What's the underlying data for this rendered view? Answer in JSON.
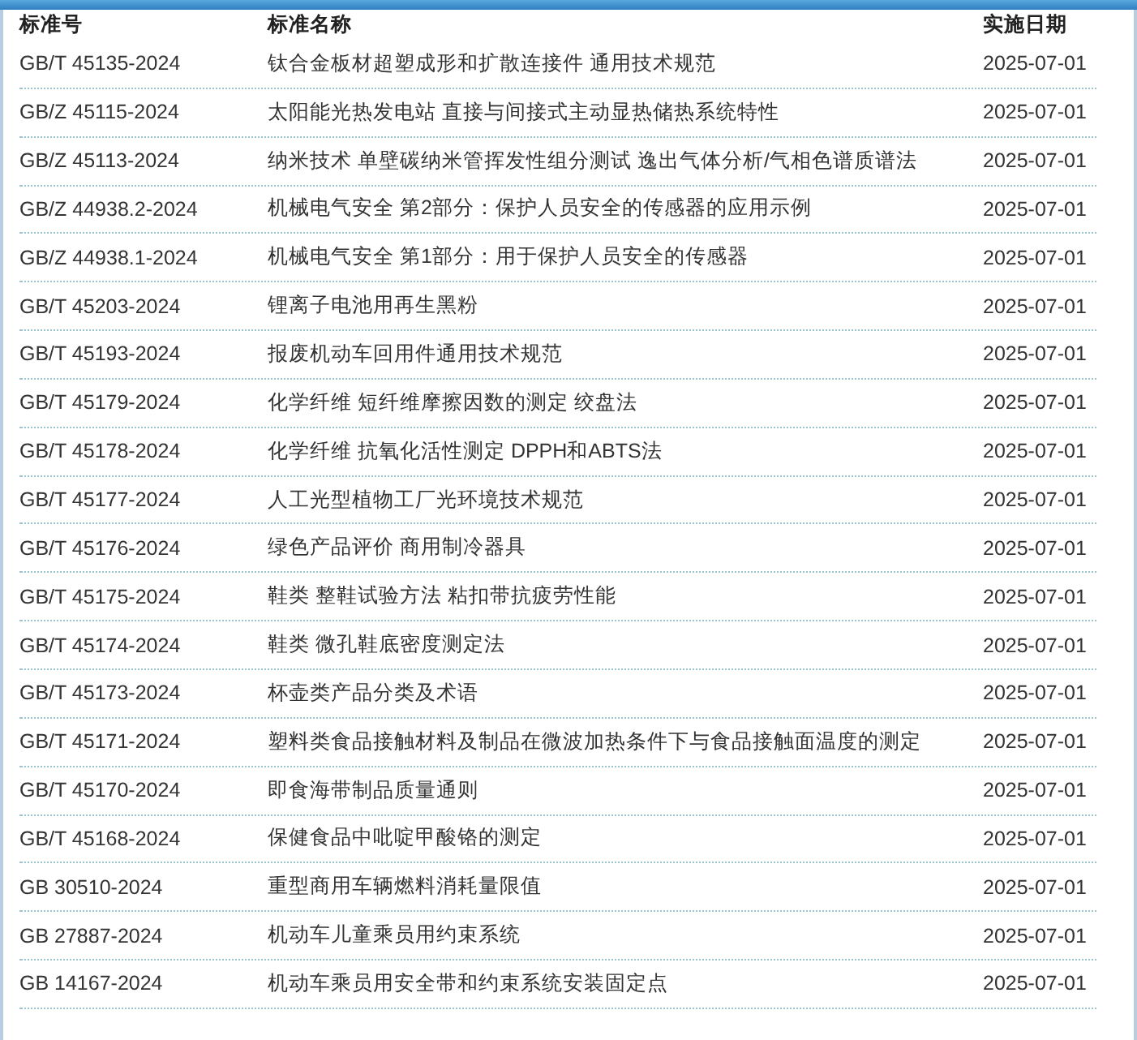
{
  "table": {
    "columns": [
      "标准号",
      "标准名称",
      "实施日期"
    ],
    "rows": [
      {
        "code": "GB/T 45135-2024",
        "name": "钛合金板材超塑成形和扩散连接件 通用技术规范",
        "date": "2025-07-01"
      },
      {
        "code": "GB/Z 45115-2024",
        "name": "太阳能光热发电站 直接与间接式主动显热储热系统特性",
        "date": "2025-07-01"
      },
      {
        "code": "GB/Z 45113-2024",
        "name": "纳米技术 单壁碳纳米管挥发性组分测试 逸出气体分析/气相色谱质谱法",
        "date": "2025-07-01"
      },
      {
        "code": "GB/Z 44938.2-2024",
        "name": "机械电气安全 第2部分：保护人员安全的传感器的应用示例",
        "date": "2025-07-01"
      },
      {
        "code": "GB/Z 44938.1-2024",
        "name": "机械电气安全 第1部分：用于保护人员安全的传感器",
        "date": "2025-07-01"
      },
      {
        "code": "GB/T 45203-2024",
        "name": "锂离子电池用再生黑粉",
        "date": "2025-07-01"
      },
      {
        "code": "GB/T 45193-2024",
        "name": "报废机动车回用件通用技术规范",
        "date": "2025-07-01"
      },
      {
        "code": "GB/T 45179-2024",
        "name": "化学纤维 短纤维摩擦因数的测定 绞盘法",
        "date": "2025-07-01"
      },
      {
        "code": "GB/T 45178-2024",
        "name": "化学纤维 抗氧化活性测定 DPPH和ABTS法",
        "date": "2025-07-01"
      },
      {
        "code": "GB/T 45177-2024",
        "name": "人工光型植物工厂光环境技术规范",
        "date": "2025-07-01"
      },
      {
        "code": "GB/T 45176-2024",
        "name": "绿色产品评价 商用制冷器具",
        "date": "2025-07-01"
      },
      {
        "code": "GB/T 45175-2024",
        "name": "鞋类 整鞋试验方法 粘扣带抗疲劳性能",
        "date": "2025-07-01"
      },
      {
        "code": "GB/T 45174-2024",
        "name": "鞋类 微孔鞋底密度测定法",
        "date": "2025-07-01"
      },
      {
        "code": "GB/T 45173-2024",
        "name": "杯壶类产品分类及术语",
        "date": "2025-07-01"
      },
      {
        "code": "GB/T 45171-2024",
        "name": "塑料类食品接触材料及制品在微波加热条件下与食品接触面温度的测定",
        "date": "2025-07-01"
      },
      {
        "code": "GB/T 45170-2024",
        "name": "即食海带制品质量通则",
        "date": "2025-07-01"
      },
      {
        "code": "GB/T 45168-2024",
        "name": "保健食品中吡啶甲酸铬的测定",
        "date": "2025-07-01"
      },
      {
        "code": "GB 30510-2024",
        "name": "重型商用车辆燃料消耗量限值",
        "date": "2025-07-01"
      },
      {
        "code": "GB 27887-2024",
        "name": "机动车儿童乘员用约束系统",
        "date": "2025-07-01"
      },
      {
        "code": "GB 14167-2024",
        "name": "机动车乘员用安全带和约束系统安装固定点",
        "date": "2025-07-01"
      }
    ]
  }
}
